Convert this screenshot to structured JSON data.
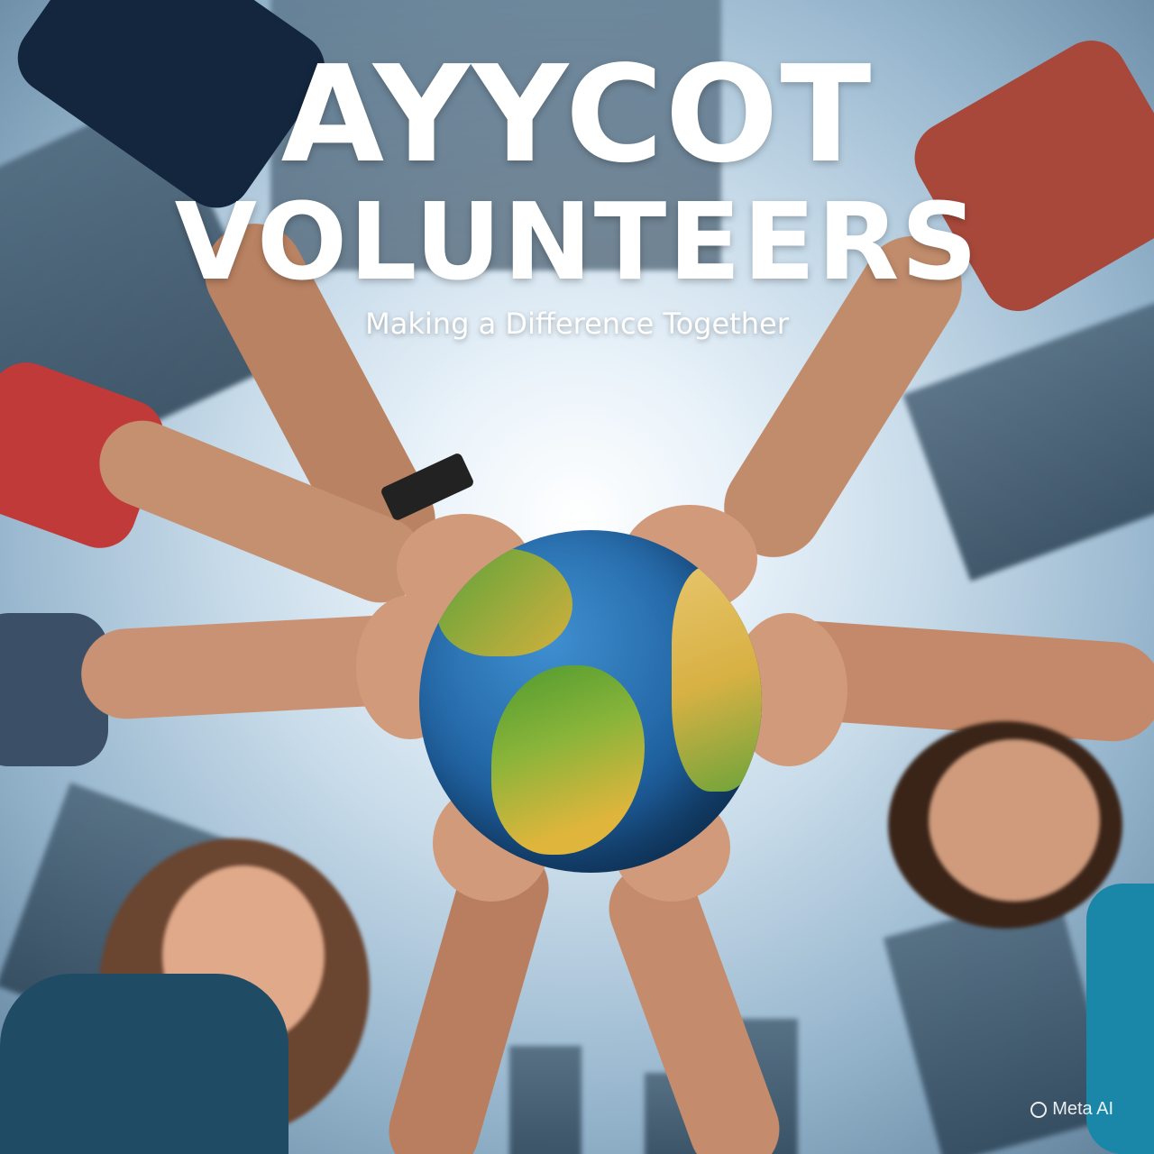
{
  "poster": {
    "title_line1": "AYYCOT",
    "title_line2": "VOLUNTEERS",
    "subtitle": "Making a Difference Together",
    "watermark": "Meta AI"
  },
  "colors": {
    "text": "#ffffff",
    "sky": "#eaf3fa",
    "ocean": "#1e5f9e",
    "land_green": "#5aa33a",
    "land_yellow": "#e0b53c"
  }
}
